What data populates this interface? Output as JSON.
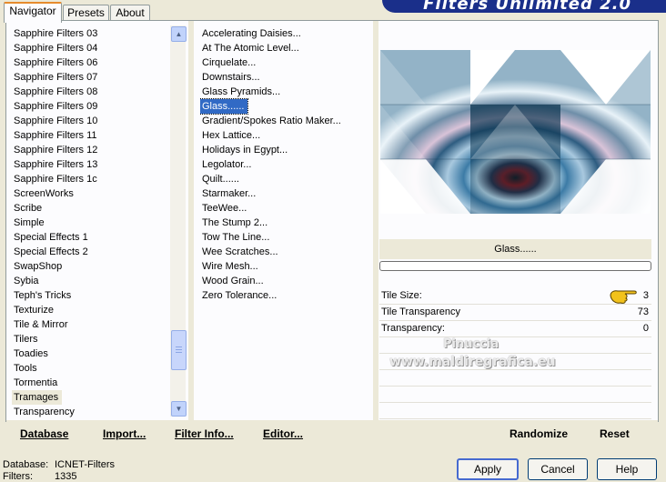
{
  "tabs": [
    {
      "label": "Navigator",
      "active": true
    },
    {
      "label": "Presets",
      "active": false
    },
    {
      "label": "About",
      "active": false
    }
  ],
  "banner_title": "Filters Unlimited 2.0",
  "categories": [
    "Sapphire Filters 03",
    "Sapphire Filters 04",
    "Sapphire Filters 06",
    "Sapphire Filters 07",
    "Sapphire Filters 08",
    "Sapphire Filters 09",
    "Sapphire Filters 10",
    "Sapphire Filters 11",
    "Sapphire Filters 12",
    "Sapphire Filters 13",
    "Sapphire Filters 1c",
    "ScreenWorks",
    "Scribe",
    "Simple",
    "Special Effects 1",
    "Special Effects 2",
    "SwapShop",
    "Sybia",
    "Teph's Tricks",
    "Texturize",
    "Tile & Mirror",
    "Tilers",
    "Toadies",
    "Tools",
    "Tormentia",
    "Tramages",
    "Transparency"
  ],
  "selected_category": "Tramages",
  "filters": [
    "Accelerating Daisies...",
    "At The Atomic Level...",
    "Cirquelate...",
    "Downstairs...",
    "Glass Pyramids...",
    "Glass......",
    "Gradient/Spokes Ratio Maker...",
    "Hex Lattice...",
    "Holidays in Egypt...",
    "Legolator...",
    "Quilt......",
    "Starmaker...",
    "TeeWee...",
    "The Stump 2...",
    "Tow The Line...",
    "Wee Scratches...",
    "Wire Mesh...",
    "Wood Grain...",
    "Zero Tolerance..."
  ],
  "selected_filter": "Glass......",
  "filter_name": "Glass......",
  "params": [
    {
      "name": "Tile Size:",
      "value": "3"
    },
    {
      "name": "Tile Transparency",
      "value": "73"
    },
    {
      "name": "Transparency:",
      "value": "0"
    }
  ],
  "watermark": {
    "line1": "Pinuccia",
    "line2": "www.maldiregrafica.eu"
  },
  "bottom_links": {
    "database": "Database",
    "import": "Import...",
    "filter_info": "Filter Info...",
    "editor": "Editor...",
    "randomize": "Randomize",
    "reset": "Reset"
  },
  "status": {
    "database_label": "Database:",
    "database_value": "ICNET-Filters",
    "filters_label": "Filters:",
    "filters_value": "1335"
  },
  "buttons": {
    "apply": "Apply",
    "cancel": "Cancel",
    "help": "Help"
  },
  "colors": {
    "selection": "#316ac5",
    "banner": "#1a2f8a",
    "background": "#ece9d8"
  }
}
